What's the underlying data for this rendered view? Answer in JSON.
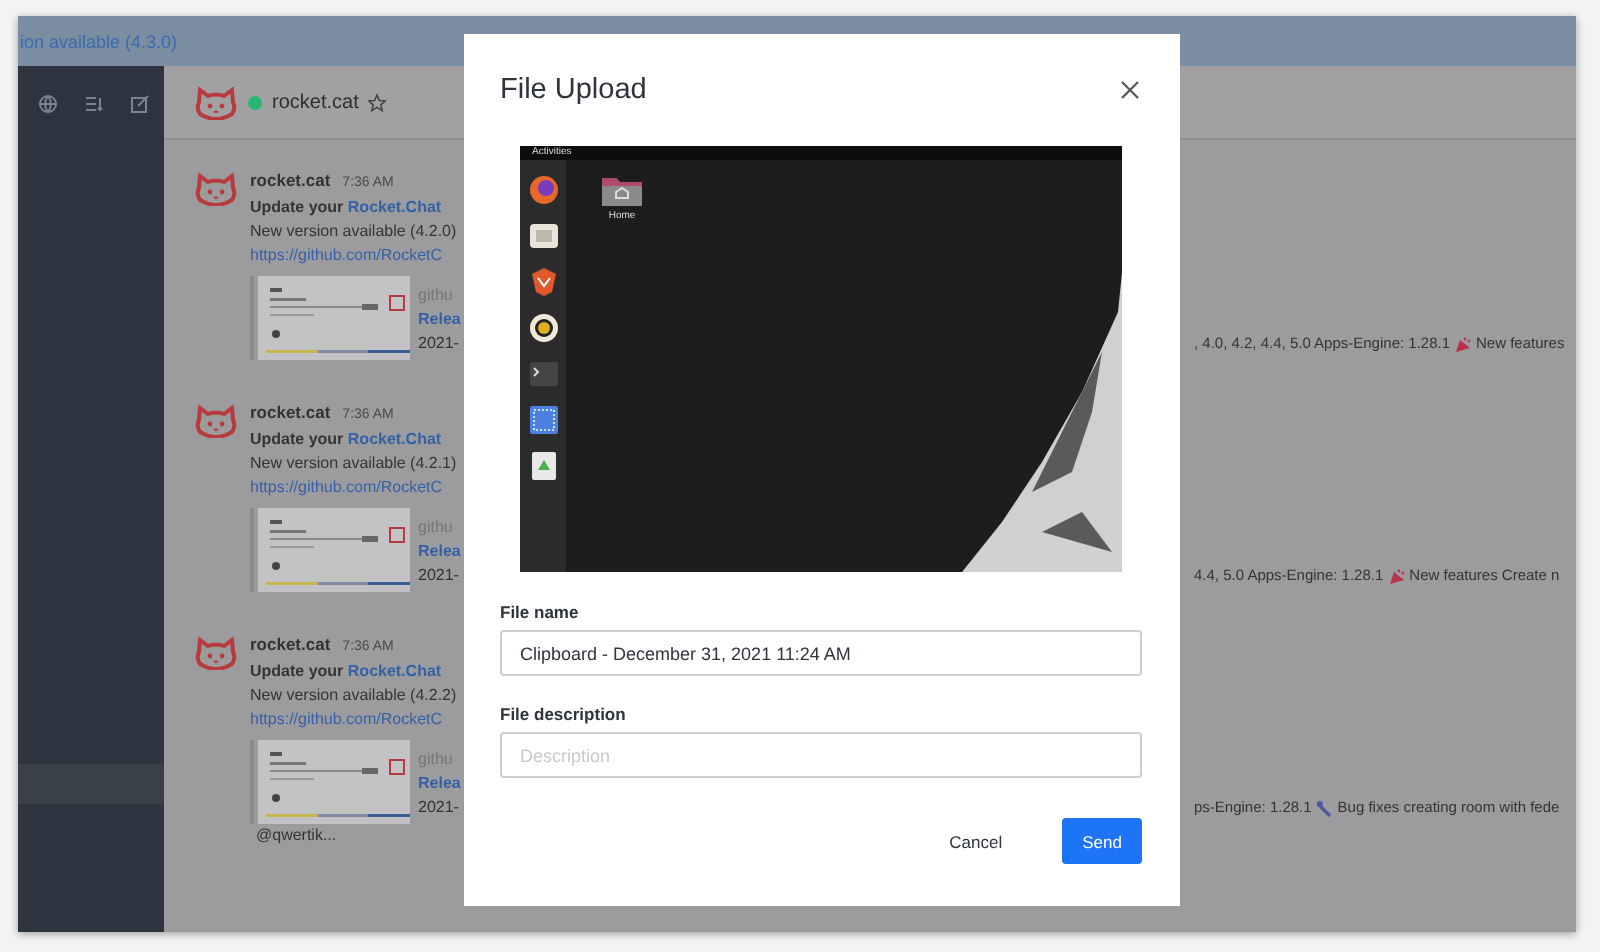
{
  "banner": {
    "text": "ion available (4.3.0)"
  },
  "room_header": {
    "name": "rocket.cat",
    "online": true,
    "starred": false
  },
  "messages": [
    {
      "author": "rocket.cat",
      "time": "7:36 AM",
      "title": "Update your ",
      "title_link": "Rocket.Chat",
      "body": "New version available (4.2.0)",
      "link": "https://github.com/RocketC",
      "preview": {
        "site": "githu",
        "title": "Relea",
        "date": "2021-"
      },
      "description": {
        "before": ", 4.0, 4.2, 4.4, 5.0 Apps-Engine: 1.28.1",
        "kind": "party",
        "after": "New features"
      }
    },
    {
      "author": "rocket.cat",
      "time": "7:36 AM",
      "title": "Update your ",
      "title_link": "Rocket.Chat",
      "body": "New version available (4.2.1)",
      "link": "https://github.com/RocketC",
      "preview": {
        "site": "githu",
        "title": "Relea",
        "date": "2021-"
      },
      "description": {
        "before": "4.4, 5.0 Apps-Engine: 1.28.1",
        "kind": "party",
        "after": "New features Create n"
      }
    },
    {
      "author": "rocket.cat",
      "time": "7:36 AM",
      "title": "Update your ",
      "title_link": "Rocket.Chat",
      "body": "New version available (4.2.2)",
      "link": "https://github.com/RocketC",
      "preview": {
        "site": "githu",
        "title": "Relea",
        "date": "2021-"
      },
      "description": {
        "before": "ps-Engine: 1.28.1",
        "kind": "bug",
        "after": "Bug fixes creating room with fede"
      },
      "mention": "@qwertik..."
    }
  ],
  "modal": {
    "title": "File Upload",
    "preview": {
      "top_bar_label": "Activities",
      "folder_label": "Home"
    },
    "fields": [
      {
        "label": "File name",
        "value": "Clipboard - December 31, 2021 11:24 AM"
      },
      {
        "label": "File description",
        "placeholder": "Description"
      }
    ],
    "buttons": [
      {
        "label": "Cancel",
        "kind": "secondary"
      },
      {
        "label": "Send",
        "kind": "primary"
      }
    ]
  }
}
